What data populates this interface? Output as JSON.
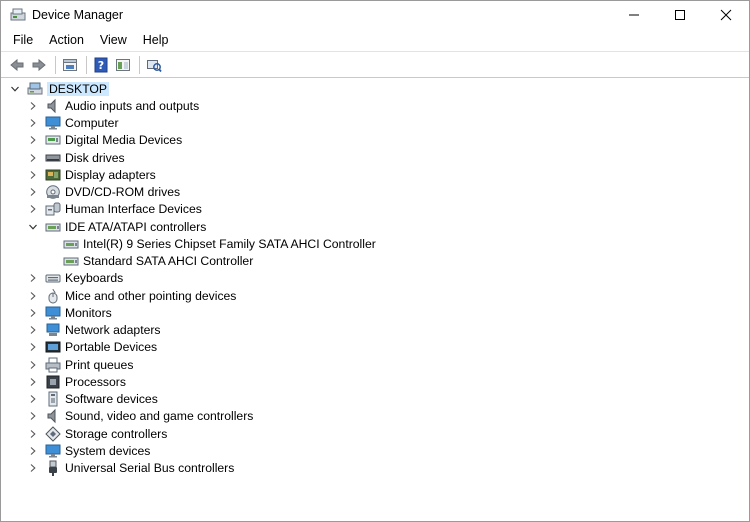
{
  "window": {
    "title": "Device Manager"
  },
  "menu": [
    "File",
    "Action",
    "View",
    "Help"
  ],
  "toolbar": {
    "buttons": [
      "back-icon",
      "forward-icon",
      "properties-icon",
      "help-icon",
      "show-hide-icon",
      "scan-hardware-icon"
    ]
  },
  "tree": {
    "root": {
      "label": "DESKTOP",
      "icon": "computer-icon",
      "expanded": true
    },
    "categories": [
      {
        "label": "Audio inputs and outputs",
        "icon": "speaker-icon"
      },
      {
        "label": "Computer",
        "icon": "monitor-icon"
      },
      {
        "label": "Digital Media Devices",
        "icon": "media-device-icon"
      },
      {
        "label": "Disk drives",
        "icon": "disk-drive-icon"
      },
      {
        "label": "Display adapters",
        "icon": "display-adapter-icon"
      },
      {
        "label": "DVD/CD-ROM drives",
        "icon": "dvd-drive-icon"
      },
      {
        "label": "Human Interface Devices",
        "icon": "hid-icon"
      },
      {
        "label": "IDE ATA/ATAPI controllers",
        "icon": "ide-controller-icon",
        "expanded": true,
        "children": [
          {
            "label": "Intel(R) 9 Series Chipset Family SATA AHCI Controller",
            "icon": "ide-controller-icon"
          },
          {
            "label": "Standard SATA AHCI Controller",
            "icon": "ide-controller-icon"
          }
        ]
      },
      {
        "label": "Keyboards",
        "icon": "keyboard-icon"
      },
      {
        "label": "Mice and other pointing devices",
        "icon": "mouse-icon"
      },
      {
        "label": "Monitors",
        "icon": "monitor-icon"
      },
      {
        "label": "Network adapters",
        "icon": "network-adapter-icon"
      },
      {
        "label": "Portable Devices",
        "icon": "portable-device-icon"
      },
      {
        "label": "Print queues",
        "icon": "printer-icon"
      },
      {
        "label": "Processors",
        "icon": "processor-icon"
      },
      {
        "label": "Software devices",
        "icon": "software-device-icon"
      },
      {
        "label": "Sound, video and game controllers",
        "icon": "speaker-icon"
      },
      {
        "label": "Storage controllers",
        "icon": "storage-controller-icon"
      },
      {
        "label": "System devices",
        "icon": "monitor-icon"
      },
      {
        "label": "Universal Serial Bus controllers",
        "icon": "usb-icon"
      }
    ]
  }
}
